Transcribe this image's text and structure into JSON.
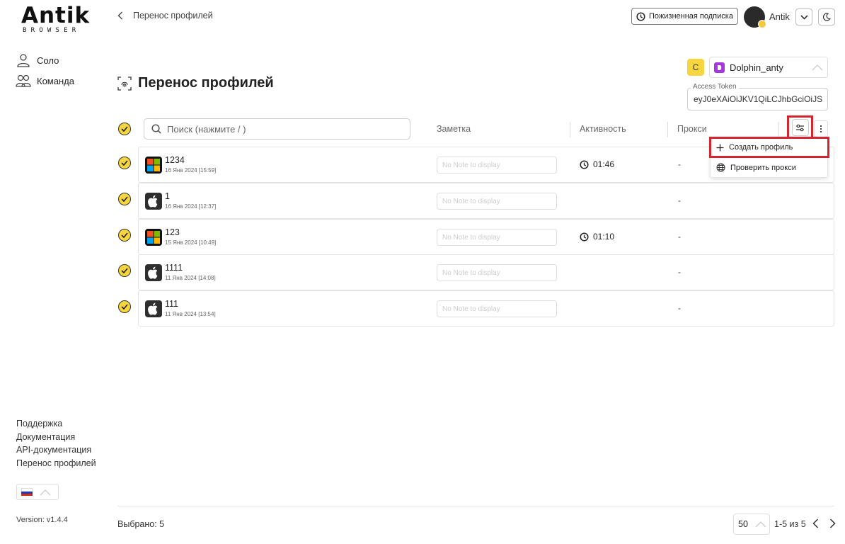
{
  "brand": {
    "logo_main": "Antik",
    "logo_sub": "BROWSER"
  },
  "sidebar": {
    "nav": [
      {
        "label": "Соло",
        "icon": "user-icon"
      },
      {
        "label": "Команда",
        "icon": "team-icon"
      }
    ],
    "links": [
      "Поддержка",
      "Документация",
      "API-документация",
      "Перенос профилей"
    ],
    "language": "ru",
    "version": "Version: v1.4.4"
  },
  "header": {
    "breadcrumb": "Перенос профилей",
    "subscription": "Пожизненная подписка",
    "user": "Antik"
  },
  "page": {
    "title": "Перенос профилей",
    "source_badge": "C",
    "source": "Dolphin_anty",
    "token_label": "Access Token",
    "token_value": "eyJ0eXAiOiJKV1QiLCJhbGciOiJS"
  },
  "table": {
    "search_placeholder": "Поиск (нажмите / )",
    "columns": {
      "note": "Заметка",
      "activity": "Активность",
      "proxy": "Прокси"
    },
    "rows": [
      {
        "name": "1234",
        "date": "16 Янв 2024 [15:59]",
        "os": "windows",
        "note_placeholder": "No Note to display",
        "activity": "01:46",
        "proxy": "-"
      },
      {
        "name": "1",
        "date": "16 Янв 2024 [12:37]",
        "os": "apple",
        "note_placeholder": "No Note to display",
        "activity": "",
        "proxy": "-"
      },
      {
        "name": "123",
        "date": "15 Янв 2024 [10:49]",
        "os": "windows",
        "note_placeholder": "No Note to display",
        "activity": "01:10",
        "proxy": "-"
      },
      {
        "name": "1111",
        "date": "11 Янв 2024 [14:08]",
        "os": "apple",
        "note_placeholder": "No Note to display",
        "activity": "",
        "proxy": "-"
      },
      {
        "name": "111",
        "date": "11 Янв 2024 [13:54]",
        "os": "apple",
        "note_placeholder": "No Note to display",
        "activity": "",
        "proxy": "-"
      }
    ]
  },
  "menu": {
    "items": [
      {
        "label": "Создать профиль",
        "icon": "plus-icon"
      },
      {
        "label": "Проверить прокси",
        "icon": "globe-icon"
      }
    ]
  },
  "footer": {
    "selected": "Выбрано: 5",
    "per_page": "50",
    "range": "1-5 из 5"
  },
  "colors": {
    "accent": "#f7d53e",
    "highlight": "#d4262f",
    "dolphin": "#a935e0"
  }
}
